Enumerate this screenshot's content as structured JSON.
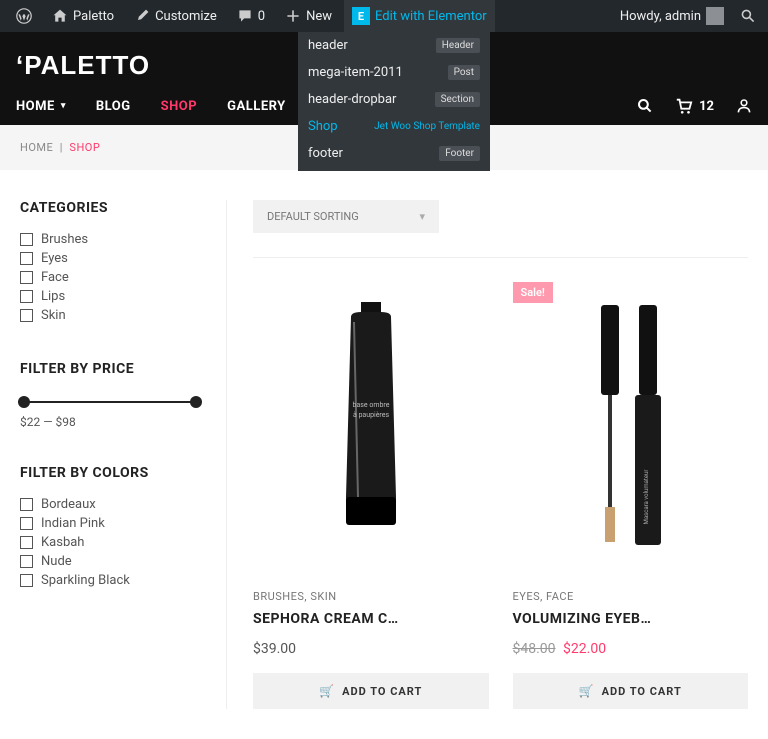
{
  "admin": {
    "site": "Paletto",
    "customize": "Customize",
    "comments": "0",
    "new": "New",
    "elementor": "Edit with Elementor",
    "howdy": "Howdy, admin"
  },
  "dropdown": [
    {
      "label": "header",
      "tag": "Header",
      "active": false
    },
    {
      "label": "mega-item-2011",
      "tag": "Post",
      "active": false
    },
    {
      "label": "header-dropbar",
      "tag": "Section",
      "active": false
    },
    {
      "label": "Shop",
      "tag": "Jet Woo Shop Template",
      "active": true,
      "jet": true
    },
    {
      "label": "footer",
      "tag": "Footer",
      "active": false
    }
  ],
  "logo": "‘PALETTO",
  "nav": {
    "home": "HOME",
    "blog": "BLOG",
    "shop": "SHOP",
    "gallery": "GALLERY",
    "cart_count": "12"
  },
  "breadcrumb": {
    "home": "HOME",
    "sep": "|",
    "current": "SHOP"
  },
  "widgets": {
    "categories": {
      "title": "CATEGORIES",
      "items": [
        "Brushes",
        "Eyes",
        "Face",
        "Lips",
        "Skin"
      ]
    },
    "price": {
      "title": "FILTER BY PRICE",
      "text": "$22 — $98"
    },
    "colors": {
      "title": "FILTER BY COLORS",
      "items": [
        "Bordeaux",
        "Indian Pink",
        "Kasbah",
        "Nude",
        "Sparkling Black"
      ]
    }
  },
  "sort": {
    "label": "DEFAULT SORTING"
  },
  "products": [
    {
      "sale": false,
      "meta": "BRUSHES, SKIN",
      "title": "SEPHORA CREAM C…",
      "price": "$39.00",
      "btn": "ADD TO CART"
    },
    {
      "sale": true,
      "sale_label": "Sale!",
      "meta": "EYES, FACE",
      "title": "VOLUMIZING EYEB…",
      "old_price": "$48.00",
      "sale_price": "$22.00",
      "btn": "ADD TO CART"
    }
  ]
}
